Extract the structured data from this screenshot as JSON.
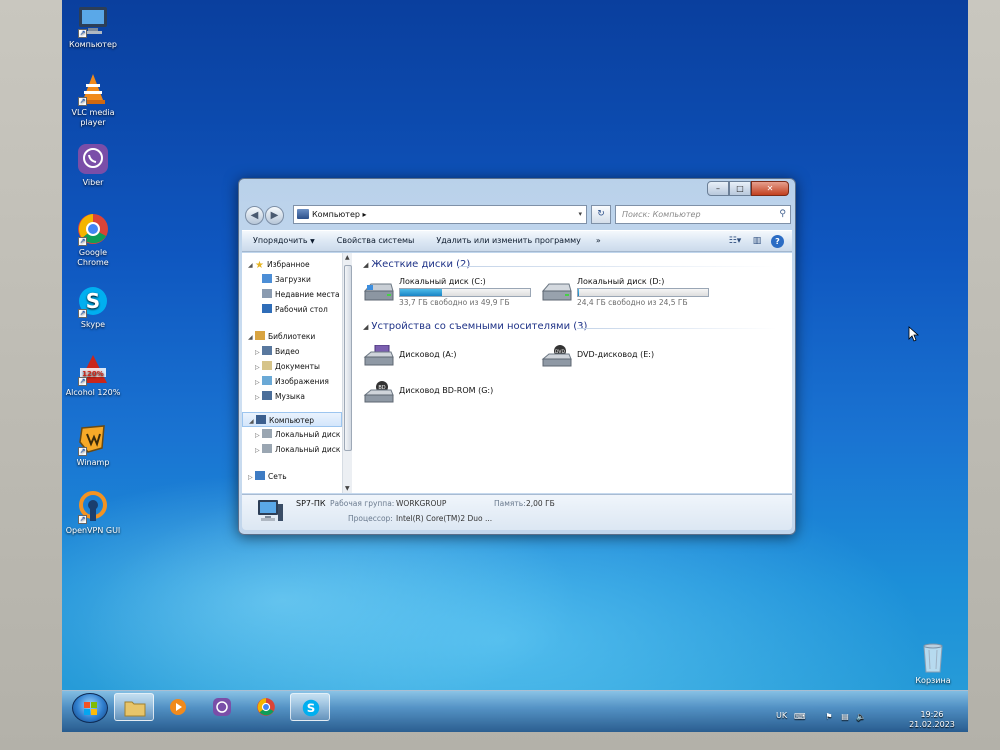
{
  "desktop": {
    "icons": [
      {
        "label": "Компьютер",
        "icon": "computer-icon"
      },
      {
        "label": "VLC media player",
        "icon": "vlc-cone-icon"
      },
      {
        "label": "Viber",
        "icon": "viber-icon"
      },
      {
        "label": "Google Chrome",
        "icon": "chrome-icon"
      },
      {
        "label": "Skype",
        "icon": "skype-icon"
      },
      {
        "label": "Alcohol 120%",
        "icon": "alcohol-icon"
      },
      {
        "label": "Winamp",
        "icon": "winamp-icon"
      },
      {
        "label": "OpenVPN GUI",
        "icon": "openvpn-icon"
      }
    ],
    "recycle_bin": {
      "label": "Корзина",
      "icon": "recycle-bin-icon"
    }
  },
  "window": {
    "title_buttons": {
      "minimize": "–",
      "maximize": "□",
      "close": "✕"
    },
    "address": {
      "path": "Компьютер ▸"
    },
    "search": {
      "placeholder": "Поиск: Компьютер"
    },
    "toolbar": {
      "organize": "Упорядочить",
      "system_properties": "Свойства системы",
      "uninstall": "Удалить или изменить программу",
      "more": "»"
    },
    "nav": {
      "favorites": "Избранное",
      "downloads": "Загрузки",
      "recent": "Недавние места",
      "desktop": "Рабочий стол",
      "libraries": "Библиотеки",
      "video": "Видео",
      "documents": "Документы",
      "images": "Изображения",
      "music": "Музыка",
      "computer": "Компьютер",
      "local_c": "Локальный диск",
      "local_d": "Локальный диск",
      "network": "Сеть"
    },
    "groups": {
      "hard_disks": "Жесткие диски (2)",
      "removable": "Устройства со съемными носителями (3)"
    },
    "drives": [
      {
        "name": "Локальный диск (C:)",
        "free": "33,7 ГБ свободно из 49,9 ГБ",
        "used_fraction": 0.32
      },
      {
        "name": "Локальный диск (D:)",
        "free": "24,4 ГБ свободно из 24,5 ГБ",
        "used_fraction": 0.01
      }
    ],
    "removable": [
      {
        "name": "Дисковод (A:)"
      },
      {
        "name": "DVD-дисковод (E:)",
        "badge": "DVD"
      },
      {
        "name": "Дисковод BD-ROM (G:)",
        "badge": "BD"
      }
    ],
    "details": {
      "pc_name": "SP7-ПК",
      "workgroup_label": "Рабочая группа:",
      "workgroup_value": "WORKGROUP",
      "memory_label": "Память:",
      "memory_value": "2,00 ГБ",
      "cpu_label": "Процессор:",
      "cpu_value": "Intel(R) Core(TM)2 Duo ..."
    }
  },
  "taskbar": {
    "language": "UK",
    "time": "19:26",
    "date": "21.02.2023"
  },
  "colors": {
    "accent": "#1e3287",
    "bar_fill": "#1984c6"
  }
}
